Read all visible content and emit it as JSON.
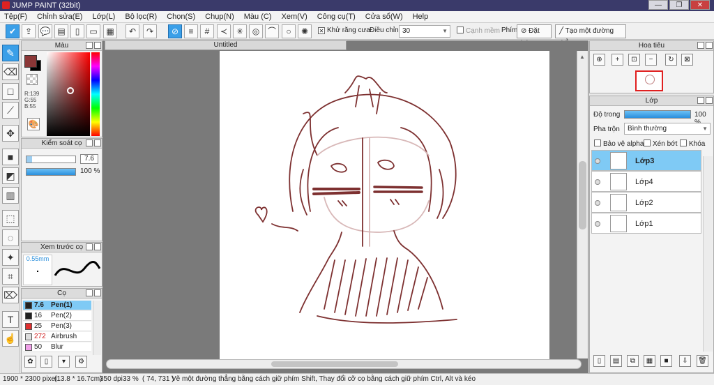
{
  "window": {
    "title": "JUMP PAINT (32bit)",
    "controls": [
      "—",
      "❐",
      "✕"
    ]
  },
  "menu": [
    "Tệp(F)",
    "Chỉnh sửa(E)",
    "Lớp(L)",
    "Bộ lọc(R)",
    "Chọn(S)",
    "Chụp(N)",
    "Màu (C)",
    "Xem(V)",
    "Công cụ(T)",
    "Cửa sổ(W)",
    "Help"
  ],
  "toolbar": {
    "antialias_label": "Khử răng cưa",
    "antialias_checked": true,
    "adjust_label": "Điều chỉnh",
    "adjust_value": "30",
    "smooth_label": "Cạnh mềm",
    "smooth_checked": false,
    "key_label": "Phím",
    "reset_label": "Đặt lại",
    "straight_line_label": "Tạo một đường thẳng"
  },
  "color_panel": {
    "title": "Màu",
    "primary_color": "#8b3737",
    "secondary_color": "#000000",
    "r": "R:139",
    "g": "G:55",
    "b": "B:55"
  },
  "brush_control": {
    "title": "Kiểm soát cọ",
    "size_value": "7.6",
    "opacity_value": "100 %"
  },
  "brush_preview": {
    "title": "Xem trước cọ",
    "size_label": "0.55mm"
  },
  "brushes": {
    "title": "Cọ",
    "items": [
      {
        "size": "7.6",
        "name": "Pen(1)",
        "color": "#222222",
        "selected": true
      },
      {
        "size": "16",
        "name": "Pen(2)",
        "color": "#222222",
        "selected": false
      },
      {
        "size": "25",
        "name": "Pen(3)",
        "color": "#e03030",
        "selected": false
      },
      {
        "size": "272",
        "name": "Airbrush",
        "color": "#dddddd",
        "selected": false
      },
      {
        "size": "50",
        "name": "Blur",
        "color": "#f0a0e8",
        "selected": false
      }
    ]
  },
  "document": {
    "tab_title": "Untitled"
  },
  "navigator": {
    "title": "Hoa tiêu"
  },
  "layers": {
    "title": "Lớp",
    "opacity_label": "Độ trong",
    "opacity_value": "100 %",
    "blend_label": "Pha trộn",
    "blend_value": "Bình thường",
    "protect_alpha_label": "Bảo vệ alpha",
    "clip_label": "Xén bớt",
    "lock_label": "Khóa",
    "items": [
      {
        "name": "Lớp3",
        "selected": true
      },
      {
        "name": "Lớp4",
        "selected": false
      },
      {
        "name": "Lớp2",
        "selected": false
      },
      {
        "name": "Lớp1",
        "selected": false
      }
    ]
  },
  "status": {
    "size": "1900 * 2300 pixel",
    "physical": "(13.8 * 16.7cm)",
    "dpi": "350 dpi",
    "zoom": "33 %",
    "cursor": "( 74, 731 )",
    "hint": "Vẽ một đường thẳng bằng cách giữ phím Shift, Thay đổi cỡ cọ bằng cách giữ phím Ctrl, Alt và kéo"
  }
}
